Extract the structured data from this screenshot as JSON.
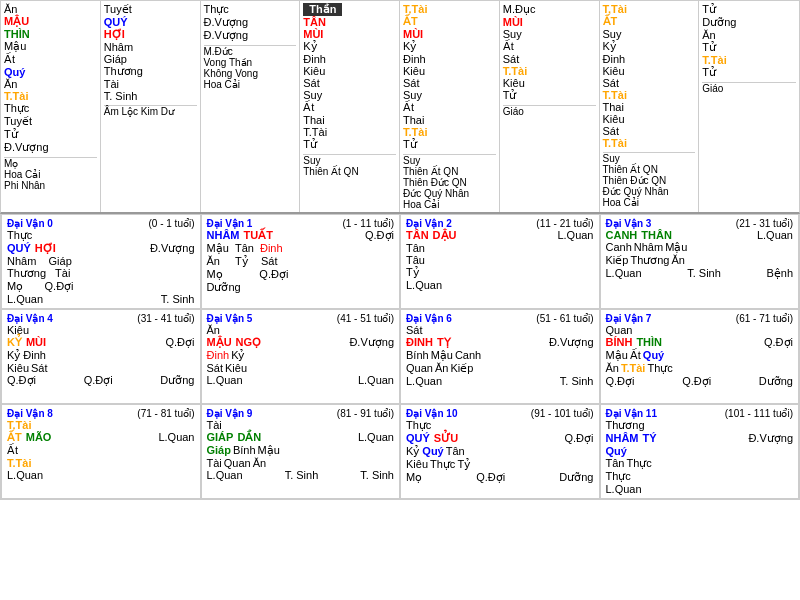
{
  "topSection": {
    "columns": [
      {
        "id": "col1",
        "lines": [
          {
            "text": "Ăn",
            "color": "black"
          },
          {
            "text": "MẬU",
            "color": "red"
          },
          {
            "text": "Mậu",
            "color": "black"
          },
          {
            "text": "Ăn",
            "color": "black"
          },
          {
            "text": "Tuyết",
            "color": "black"
          }
        ],
        "sub": [
          {
            "text": "THÌN",
            "color": "green"
          },
          {
            "text": "Ất",
            "color": "black"
          },
          {
            "text": "T.Tài",
            "color": "orange"
          },
          {
            "text": "Tử",
            "color": "black"
          }
        ],
        "sub2": [
          {
            "text": "Quý",
            "color": "blue"
          },
          {
            "text": "Thực",
            "color": "black"
          },
          {
            "text": "Đ.Vượng",
            "color": "black"
          }
        ],
        "mo": "Mọ",
        "moLines": [
          "Hoa Cải",
          "Phi Nhân"
        ]
      },
      {
        "id": "col2",
        "lines": [
          {
            "text": "Tuyết",
            "color": "black"
          },
          {
            "text": "QUÝ",
            "color": "blue"
          },
          {
            "text": "Nhâm",
            "color": "black"
          },
          {
            "text": "Thương",
            "color": "black"
          },
          {
            "text": "T. Sinh",
            "color": "black"
          }
        ],
        "sub": [
          {
            "text": "HỢI",
            "color": "red"
          },
          {
            "text": "Giáp",
            "color": "black"
          },
          {
            "text": "Tài",
            "color": "black"
          }
        ],
        "sub2": [],
        "mo": "",
        "moLines": [
          "Âm Lộc Kim Dư",
          ""
        ]
      },
      {
        "id": "col3",
        "lines": [
          {
            "text": "Thực",
            "color": "black"
          },
          {
            "text": "Đ.Vượng",
            "color": "black"
          },
          {
            "text": "Đ.Vượng",
            "color": "black"
          }
        ],
        "sub": [],
        "sub2": [],
        "mo": "M.Đức",
        "moLines": [
          "Vong Thần",
          "Không Vong",
          "Hoa Cải"
        ]
      },
      {
        "id": "col4-than",
        "isТhan": true,
        "lines": [
          {
            "text": "Thần",
            "color": "white",
            "bg": "dark"
          },
          {
            "text": "TÂN",
            "color": "red"
          },
          {
            "text": "Kỷ",
            "color": "black"
          },
          {
            "text": "Kiêu",
            "color": "black"
          },
          {
            "text": "Thai",
            "color": "black"
          }
        ],
        "sub": [
          {
            "text": "MÙI",
            "color": "red"
          },
          {
            "text": "Đinh",
            "color": "black"
          },
          {
            "text": "Sát",
            "color": "black"
          },
          {
            "text": "T.Tài",
            "color": "orange"
          }
        ],
        "sub2": [
          {
            "text": "Suy",
            "color": "black"
          },
          {
            "text": "Ất",
            "color": "black"
          },
          {
            "text": "Tử",
            "color": "black"
          }
        ],
        "mo": "Suy",
        "moLines": [
          "Thiên Ất QN",
          ""
        ]
      },
      {
        "id": "col5",
        "lines": [
          {
            "text": "T.Tài",
            "color": "orange"
          },
          {
            "text": "ẤT",
            "color": "orange"
          },
          {
            "text": "Kỷ",
            "color": "black"
          },
          {
            "text": "Kiêu",
            "color": "black"
          },
          {
            "text": "Thai",
            "color": "black"
          }
        ],
        "sub": [
          {
            "text": "MÙI",
            "color": "red"
          },
          {
            "text": "Đinh",
            "color": "black"
          },
          {
            "text": "Sát",
            "color": "black"
          },
          {
            "text": "T.Tài",
            "color": "orange"
          }
        ],
        "sub2": [
          {
            "text": "Suy",
            "color": "black"
          },
          {
            "text": "Ất",
            "color": "black"
          },
          {
            "text": "T.Tài",
            "color": "orange"
          },
          {
            "text": "Tử",
            "color": "black"
          }
        ],
        "mo": "Suy",
        "moLines": [
          "Thiên Ất QN",
          "Thiên Đức QN",
          "Đức Quý Nhân",
          "Hoa Cải"
        ]
      }
    ]
  },
  "daiVanRows": [
    [
      {
        "title": "Đại Vận 0",
        "age": "(0 - 1 tuổi)",
        "main1": {
          "text": "Thực",
          "color": "black"
        },
        "main2": {
          "text": "QUÝ",
          "color": "blue"
        },
        "main3": {
          "text": "Nhâm",
          "color": "black"
        },
        "main4": {
          "text": "Thương",
          "color": "black"
        },
        "mainR": {
          "text": "Đ.Vượng",
          "color": "black"
        },
        "sub1": {
          "text": "HỢI",
          "color": "red"
        },
        "sub1R": {
          "text": "",
          "color": ""
        },
        "sub2": {
          "text": "Giáp",
          "color": "black"
        },
        "sub2R": {
          "text": "Tài",
          "color": "black"
        },
        "sub3": {
          "text": "Mọ",
          "color": "black"
        },
        "sub3R": {
          "text": "Q.Đợi",
          "color": "black"
        },
        "bottom": "L.Quan",
        "bottomR": "T. Sinh"
      },
      {
        "title": "Đại Vận 1",
        "age": "(1 - 11 tuổi)",
        "main1": {
          "text": "NHÂM",
          "color": "blue"
        },
        "main2": {
          "text": "TUẤT",
          "color": "red"
        },
        "main2R": {
          "text": "Q.Đợi",
          "color": "black"
        },
        "sub1": {
          "text": "Mậu",
          "color": "black"
        },
        "sub2": {
          "text": "Tân",
          "color": "black"
        },
        "sub2c": {
          "text": "Đinh",
          "color": "red"
        },
        "sub3": {
          "text": "Ăn",
          "color": "black"
        },
        "sub3c": {
          "text": "Tỷ",
          "color": "black"
        },
        "sub3R": {
          "text": "Sát",
          "color": "black"
        },
        "bottom": "Mọ",
        "bottomR": "Q.Đợi",
        "extra": "Dưỡng"
      },
      {
        "title": "Đại Vận 2",
        "age": "(11 - 21 tuổi)",
        "main1": {
          "text": "TÂN",
          "color": "red"
        },
        "main2": {
          "text": "DẬU",
          "color": "red"
        },
        "main2R": {
          "text": "L.Quan",
          "color": "black"
        },
        "sub1": {
          "text": "Tân",
          "color": "black"
        },
        "sub2": {
          "text": "Tâu",
          "color": "black"
        },
        "sub3": {
          "text": "Tỷ",
          "color": "black"
        },
        "bottom": "L.Quan",
        "bottomR": ""
      },
      {
        "title": "Đại Vận 3",
        "age": "(21 - 31 tuổi)",
        "main1": {
          "text": "CANH",
          "color": "green"
        },
        "main2": {
          "text": "THÂN",
          "color": "green"
        },
        "main2R": {
          "text": "L.Quan",
          "color": "black"
        },
        "sub1": {
          "text": "Canh",
          "color": "black"
        },
        "sub2": {
          "text": "Nhâm",
          "color": "black"
        },
        "sub2c": {
          "text": "Mậu",
          "color": "black"
        },
        "sub3": {
          "text": "Kiếp",
          "color": "black"
        },
        "sub3c": {
          "text": "Thương",
          "color": "black"
        },
        "sub3R": {
          "text": "Ăn",
          "color": "black"
        },
        "bottom": "L.Quan",
        "bottomR": "T. Sinh",
        "extra": "Bệnh"
      }
    ],
    [
      {
        "title": "Đại Vận 4",
        "age": "(31 - 41 tuổi)",
        "main1": {
          "text": "Kiêu",
          "color": "black"
        },
        "main2": {
          "text": "KỶ",
          "color": "orange"
        },
        "main2c": {
          "text": "MÙI",
          "color": "red"
        },
        "main2R": {
          "text": "Q.Đợi",
          "color": "black"
        },
        "sub1": {
          "text": "Kỷ",
          "color": "black"
        },
        "sub2": {
          "text": "Đinh",
          "color": "red"
        },
        "sub3": {
          "text": "Kiêu",
          "color": "black"
        },
        "sub3R": {
          "text": "Sát",
          "color": "black"
        },
        "bottom": "Q.Đợi",
        "bottomR": "Q.Đợi",
        "extra": "Dưỡng"
      },
      {
        "title": "Đại Vận 5",
        "age": "(41 - 51 tuổi)",
        "main1": {
          "text": "Ăn",
          "color": "black"
        },
        "main2": {
          "text": "MẬU",
          "color": "red"
        },
        "main2c": {
          "text": "NGỌ",
          "color": "red"
        },
        "main2R": {
          "text": "Đ.Vượng",
          "color": "black"
        },
        "sub1": {
          "text": "Đinh",
          "color": "red"
        },
        "sub2": {
          "text": "Kỷ",
          "color": "black"
        },
        "sub3": {
          "text": "Sát",
          "color": "black"
        },
        "sub3R": {
          "text": "Kiêu",
          "color": "black"
        },
        "bottom": "L.Quan",
        "bottomR": "L.Quan"
      },
      {
        "title": "Đại Vận 6",
        "age": "(51 - 61 tuổi)",
        "main1": {
          "text": "Sát",
          "color": "black"
        },
        "main2": {
          "text": "ĐINH",
          "color": "red"
        },
        "main2c": {
          "text": "TỴ",
          "color": "red"
        },
        "main2R": {
          "text": "Đ.Vượng",
          "color": "black"
        },
        "sub1": {
          "text": "Bính",
          "color": "black"
        },
        "sub2": {
          "text": "Mậu",
          "color": "black"
        },
        "sub2c": {
          "text": "Canh",
          "color": "black"
        },
        "sub3": {
          "text": "Quan",
          "color": "black"
        },
        "sub3c": {
          "text": "Ăn",
          "color": "black"
        },
        "sub3R": {
          "text": "Kiếp",
          "color": "black"
        },
        "bottom": "L.Quan",
        "bottomR": "T. Sinh"
      },
      {
        "title": "Đại Vận 7",
        "age": "(61 - 71 tuổi)",
        "main1": {
          "text": "Quan",
          "color": "black"
        },
        "main2": {
          "text": "BÍNH",
          "color": "red"
        },
        "main2c": {
          "text": "THÌN",
          "color": "green"
        },
        "main2R": {
          "text": "Q.Đợi",
          "color": "black"
        },
        "sub1": {
          "text": "Mậu",
          "color": "black"
        },
        "sub2": {
          "text": "Ất",
          "color": "black"
        },
        "sub2c": {
          "text": "Quý",
          "color": "blue"
        },
        "sub3": {
          "text": "Ăn",
          "color": "black"
        },
        "sub3c": {
          "text": "T.Tài",
          "color": "orange"
        },
        "sub3R": {
          "text": "Thực",
          "color": "black"
        },
        "bottom": "Q.Đợi",
        "bottomR": "Q.Đợi",
        "extra": "Dưỡng"
      }
    ],
    [
      {
        "title": "Đại Vận 8",
        "age": "(71 - 81 tuổi)",
        "main1": {
          "text": "T.Tài",
          "color": "orange"
        },
        "main2": {
          "text": "ẤT",
          "color": "orange"
        },
        "main2c": {
          "text": "MÃO",
          "color": "green"
        },
        "main2R": {
          "text": "L.Quan",
          "color": "black"
        },
        "sub1": {
          "text": "Ất",
          "color": "black"
        },
        "sub2": {
          "text": "T.Tài",
          "color": "orange"
        },
        "bottom": "L.Quan",
        "bottomR": ""
      },
      {
        "title": "Đại Vận 9",
        "age": "(81 - 91 tuổi)",
        "main1": {
          "text": "Tài",
          "color": "black"
        },
        "main2": {
          "text": "GIÁP",
          "color": "green"
        },
        "main2c": {
          "text": "DẦN",
          "color": "green"
        },
        "main2R": {
          "text": "L.Quan",
          "color": "black"
        },
        "sub1": {
          "text": "Giáp",
          "color": "green"
        },
        "sub2": {
          "text": "Bính",
          "color": "black"
        },
        "sub2c": {
          "text": "Mậu",
          "color": "black"
        },
        "sub3": {
          "text": "Tài",
          "color": "black"
        },
        "sub3c": {
          "text": "Quan",
          "color": "black"
        },
        "sub3R": {
          "text": "Ăn",
          "color": "black"
        },
        "bottom": "L.Quan",
        "bottomR": "T. Sinh",
        "extra": "T. Sinh"
      },
      {
        "title": "Đại Vận 10",
        "age": "(91 - 101 tuổi)",
        "main1": {
          "text": "Thực",
          "color": "black"
        },
        "main2": {
          "text": "QUÝ",
          "color": "blue"
        },
        "main2c": {
          "text": "SỬU",
          "color": "red"
        },
        "main2R": {
          "text": "Q.Đợi",
          "color": "black"
        },
        "sub1": {
          "text": "Kỷ",
          "color": "black"
        },
        "sub2": {
          "text": "Quý",
          "color": "blue"
        },
        "sub2c": {
          "text": "Tân",
          "color": "black"
        },
        "sub3": {
          "text": "Kiêu",
          "color": "black"
        },
        "sub3c": {
          "text": "Thực",
          "color": "black"
        },
        "sub3R": {
          "text": "Tỷ",
          "color": "black"
        },
        "bottom": "Mọ",
        "bottomR": "Q.Đợi",
        "extra": "Dưỡng"
      },
      {
        "title": "Đại Vận 11",
        "age": "(101 - 111 tuổi)",
        "main1": {
          "text": "Thương",
          "color": "black"
        },
        "main2": {
          "text": "NHÂM",
          "color": "blue"
        },
        "main2c": {
          "text": "TÝ",
          "color": "blue"
        },
        "main2R": {
          "text": "Đ.Vượng",
          "color": "black"
        },
        "sub1": {
          "text": "Quý",
          "color": "blue"
        },
        "sub2": {
          "text": "Tân",
          "color": "black"
        },
        "sub2R": {
          "text": "Thực",
          "color": "black"
        },
        "bottom": "L.Quan",
        "bottomR": ""
      }
    ]
  ]
}
